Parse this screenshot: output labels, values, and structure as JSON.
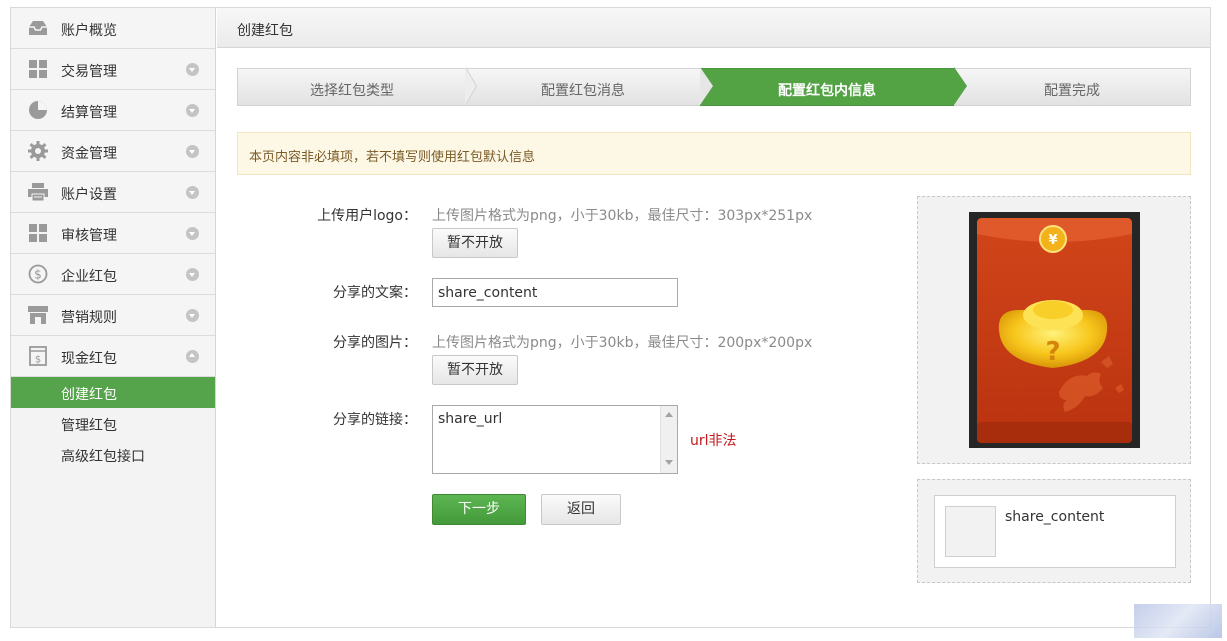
{
  "sidebar": {
    "items": [
      {
        "label": "账户概览",
        "icon": "inbox-icon",
        "has_arrow": false
      },
      {
        "label": "交易管理",
        "icon": "grid-icon",
        "has_arrow": true
      },
      {
        "label": "结算管理",
        "icon": "pie-chart-icon",
        "has_arrow": true
      },
      {
        "label": "资金管理",
        "icon": "gear-icon",
        "has_arrow": true
      },
      {
        "label": "账户设置",
        "icon": "printer-icon",
        "has_arrow": true
      },
      {
        "label": "审核管理",
        "icon": "grid-icon",
        "has_arrow": true
      },
      {
        "label": "企业红包",
        "icon": "dollar-coin-icon",
        "has_arrow": true
      },
      {
        "label": "营销规则",
        "icon": "store-icon",
        "has_arrow": true
      },
      {
        "label": "现金红包",
        "icon": "money-bag-icon",
        "has_arrow": true,
        "expanded": true
      }
    ],
    "subitems": [
      {
        "label": "创建红包",
        "active": true
      },
      {
        "label": "管理红包",
        "active": false
      },
      {
        "label": "高级红包接口",
        "active": false
      }
    ]
  },
  "header": {
    "title": "创建红包"
  },
  "steps": [
    {
      "label": "选择红包类型",
      "active": false
    },
    {
      "label": "配置红包消息",
      "active": false
    },
    {
      "label": "配置红包内信息",
      "active": true
    },
    {
      "label": "配置完成",
      "active": false
    }
  ],
  "notice": "本页内容非必填项，若不填写则使用红包默认信息",
  "form": {
    "logo_label": "上传用户logo：",
    "logo_hint": "上传图片格式为png，小于30kb，最佳尺寸：303px*251px",
    "logo_button": "暂不开放",
    "share_text_label": "分享的文案：",
    "share_text_value": "share_content",
    "share_image_label": "分享的图片：",
    "share_image_hint": "上传图片格式为png，小于30kb，最佳尺寸：200px*200px",
    "share_image_button": "暂不开放",
    "share_link_label": "分享的链接：",
    "share_link_value": "share_url",
    "share_link_error": "url非法",
    "next_button": "下一步",
    "back_button": "返回"
  },
  "preview": {
    "coin_symbol": "¥",
    "question_mark": "?",
    "share_content": "share_content"
  },
  "colors": {
    "accent_green": "#55a34b",
    "envelope_red": "#c63d14",
    "error_red": "#c4171c"
  }
}
